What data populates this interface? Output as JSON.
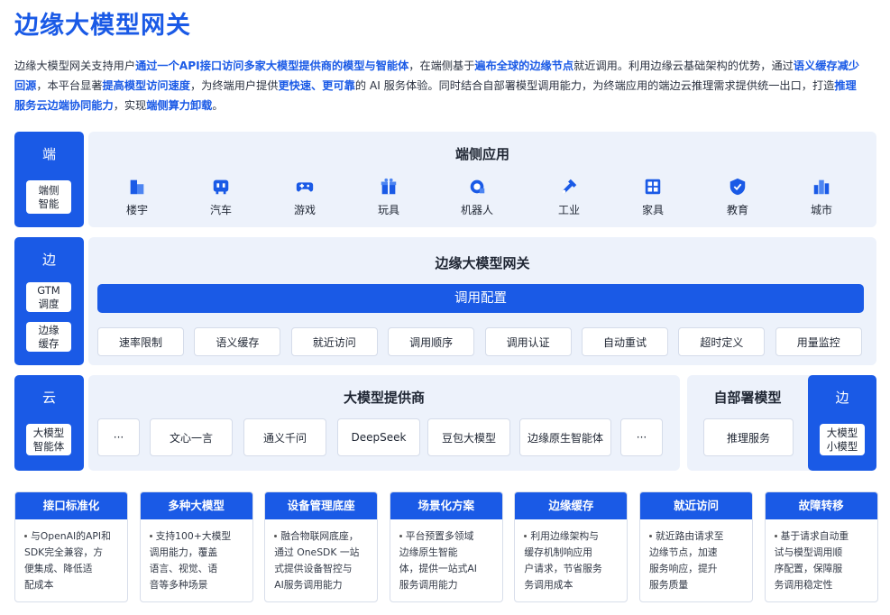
{
  "title": "边缘大模型网关",
  "intro": [
    {
      "t": "边缘大模型网关支持用户",
      "hl": false
    },
    {
      "t": "通过一个API接口访问多家大模型提供商的模型与智能体",
      "hl": true
    },
    {
      "t": "，在端侧基于",
      "hl": false
    },
    {
      "t": "遍布全球的边缘节点",
      "hl": true
    },
    {
      "t": "就近调用。利用边缘云基础架构的优势，通过",
      "hl": false
    },
    {
      "t": "语义缓存减少回源",
      "hl": true
    },
    {
      "t": "，本平台显著",
      "hl": false
    },
    {
      "t": "提高模型访问速度",
      "hl": true
    },
    {
      "t": "，为终端用户提供",
      "hl": false
    },
    {
      "t": "更快速、更可靠",
      "hl": true
    },
    {
      "t": "的 AI 服务体验。同时结合自部署模型调用能力，为终端应用的端边云推理需求提供统一出口，打造",
      "hl": false
    },
    {
      "t": "推理服务云边端协同能力",
      "hl": true
    },
    {
      "t": "，实现",
      "hl": false
    },
    {
      "t": "端侧算力卸载",
      "hl": true
    },
    {
      "t": "。",
      "hl": false
    }
  ],
  "row_device": {
    "side_title": "端",
    "tag": "端侧\n智能",
    "panel_title": "端侧应用",
    "apps": [
      "楼宇",
      "汽车",
      "游戏",
      "玩具",
      "机器人",
      "工业",
      "家具",
      "教育",
      "城市"
    ]
  },
  "row_edge": {
    "side_title": "边",
    "tags": [
      "GTM\n调度",
      "边缘\n缓存"
    ],
    "panel_title": "边缘大模型网关",
    "bar_label": "调用配置",
    "chips": [
      "速率限制",
      "语义缓存",
      "就近访问",
      "调用顺序",
      "调用认证",
      "自动重试",
      "超时定义",
      "用量监控"
    ]
  },
  "row_cloud": {
    "side_title": "云",
    "tag": "大模型\n智能体",
    "panel_title": "大模型提供商",
    "chips": [
      "···",
      "文心一言",
      "通义千问",
      "DeepSeek",
      "豆包大模型",
      "边缘原生智能体",
      "···"
    ],
    "self_title": "自部署模型",
    "self_chip": "推理服务",
    "right_side_title": "边",
    "right_tag": "大模型\n小模型"
  },
  "cards": [
    {
      "head": "接口标准化",
      "lines": [
        "与OpenAI的API和",
        "SDK完全兼容，方",
        "便集成、降低适",
        "配成本"
      ]
    },
    {
      "head": "多种大模型",
      "lines": [
        "支持100+大模型",
        "调用能力，覆盖",
        "语言、视觉、语",
        "音等多种场景"
      ]
    },
    {
      "head": "设备管理底座",
      "lines": [
        "融合物联网底座，",
        "通过 OneSDK 一站",
        "式提供设备智控与",
        "AI服务调用能力"
      ]
    },
    {
      "head": "场景化方案",
      "lines": [
        "平台预置多领域",
        "边缘原生智能",
        "体，提供一站式AI",
        "服务调用能力"
      ]
    },
    {
      "head": "边缘缓存",
      "lines": [
        "利用边缘架构与",
        "缓存机制响应用",
        "户请求，节省服务",
        "务调用成本"
      ]
    },
    {
      "head": "就近访问",
      "lines": [
        "就近路由请求至",
        "边缘节点，加速",
        "服务响应，提升",
        "服务质量"
      ]
    },
    {
      "head": "故障转移",
      "lines": [
        "基于请求自动重",
        "试与模型调用顺",
        "序配置，保障服",
        "务调用稳定性"
      ]
    }
  ],
  "colors": {
    "accent": "#1a5ae6",
    "panel": "#edf2fb"
  }
}
